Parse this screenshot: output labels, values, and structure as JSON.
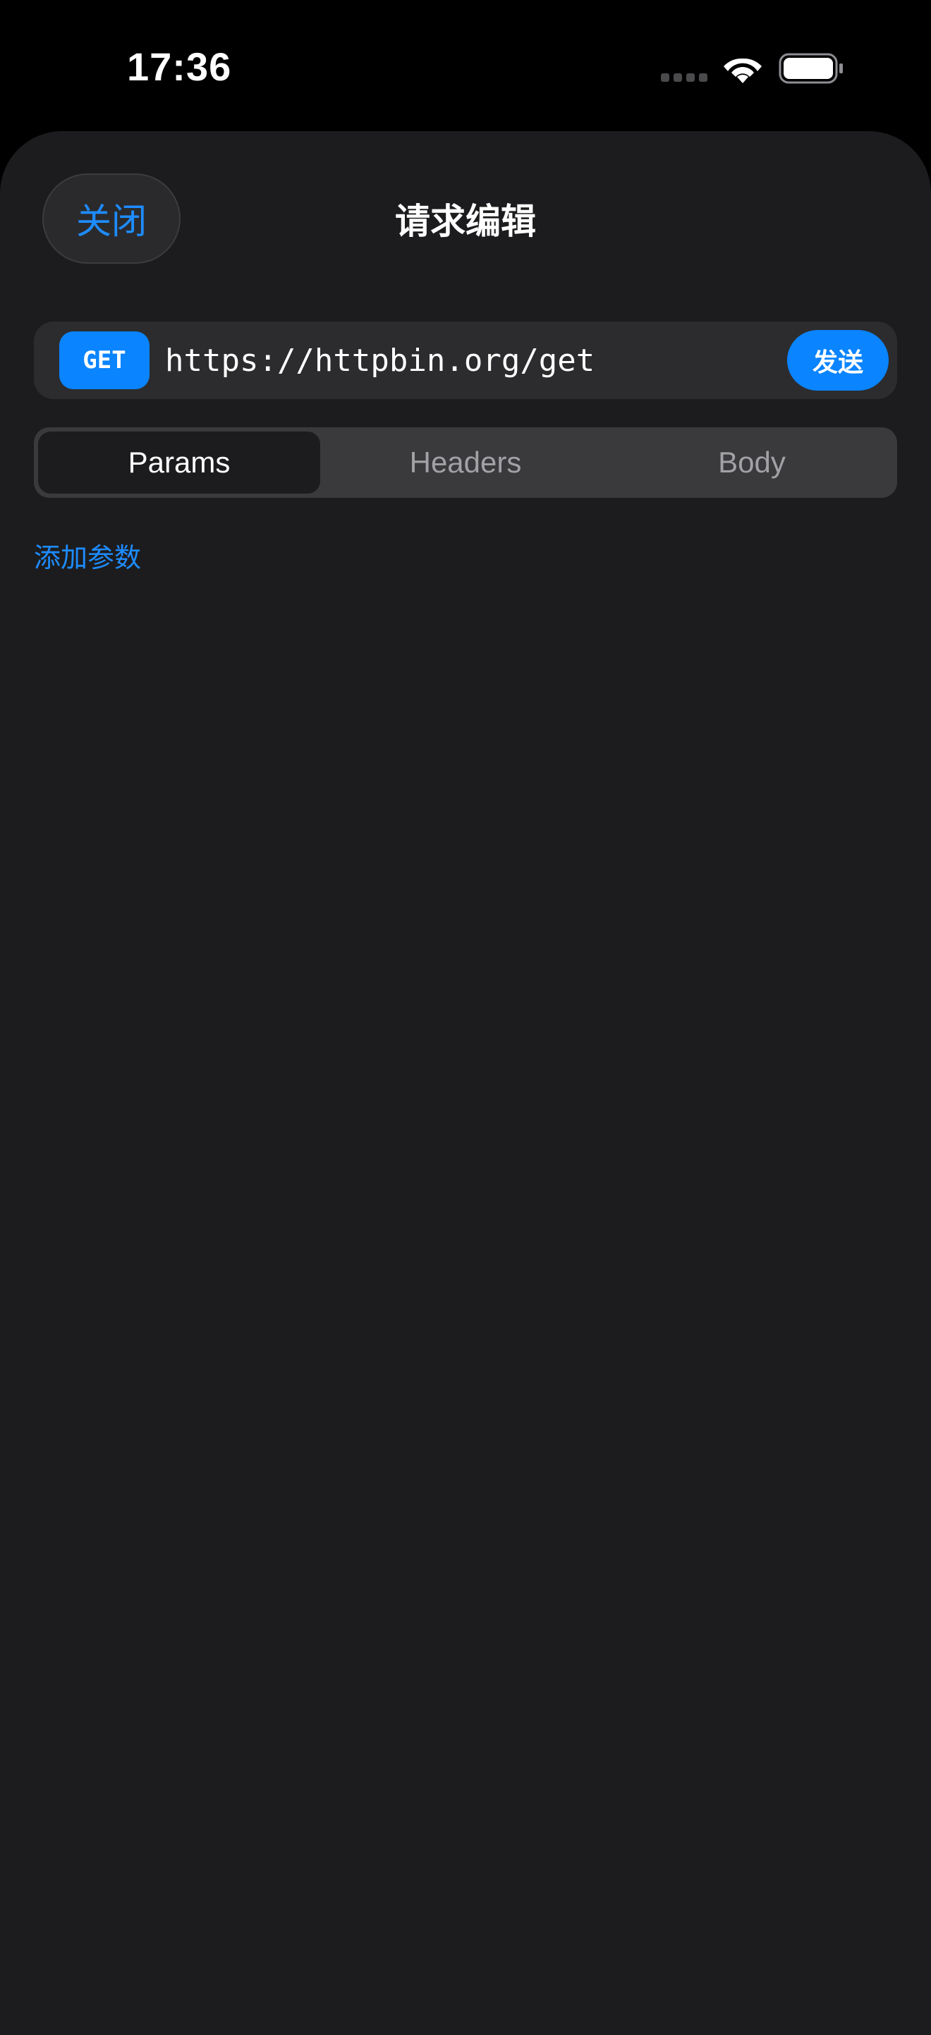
{
  "status_bar": {
    "time": "17:36"
  },
  "header": {
    "close_label": "关闭",
    "title": "请求编辑"
  },
  "request": {
    "method": "GET",
    "url": "https://httpbin.org/get",
    "send_label": "发送"
  },
  "tabs": [
    {
      "label": "Params",
      "active": true
    },
    {
      "label": "Headers",
      "active": false
    },
    {
      "label": "Body",
      "active": false
    }
  ],
  "params": {
    "add_label": "添加参数"
  },
  "colors": {
    "accent": "#0a84ff",
    "link": "#1e8cff",
    "sheet_background": "#1c1c1e",
    "segment_background": "#3a3a3c"
  },
  "icons": {
    "signal": "cellular-signal-icon",
    "wifi": "wifi-icon",
    "battery": "battery-icon"
  }
}
